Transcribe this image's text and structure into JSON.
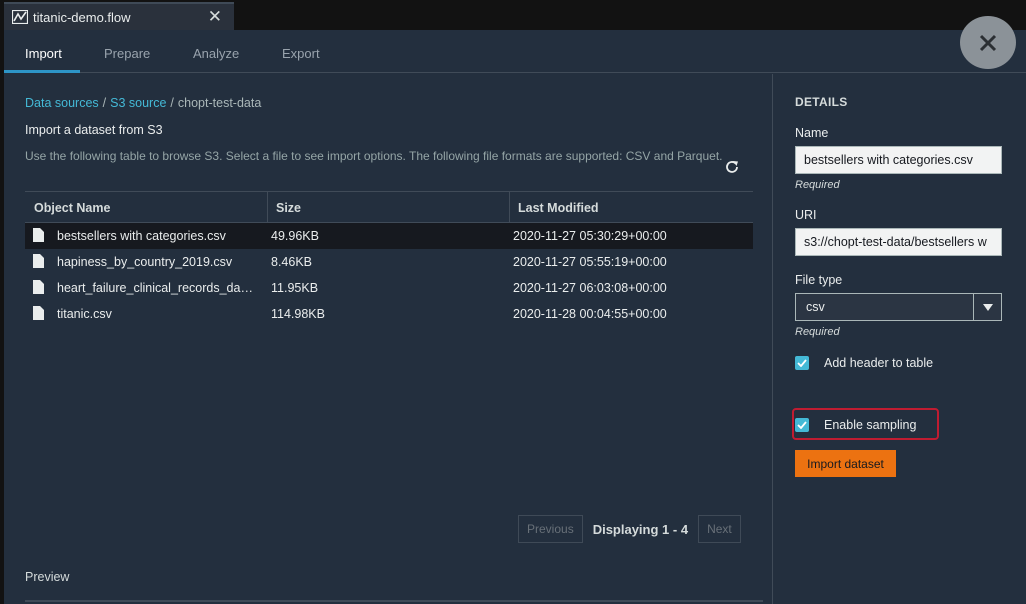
{
  "file_tab": {
    "name": "titanic-demo.flow",
    "close_glyph": "✕",
    "icon": "flow-icon"
  },
  "nav": {
    "tabs": [
      {
        "label": "Import",
        "active": true
      },
      {
        "label": "Prepare",
        "active": false
      },
      {
        "label": "Analyze",
        "active": false
      },
      {
        "label": "Export",
        "active": false
      }
    ],
    "close_icon": "close-icon"
  },
  "breadcrumb": {
    "items": [
      "Data sources",
      "S3 source",
      "chopt-test-data"
    ],
    "separator": "/"
  },
  "main": {
    "title": "Import a dataset from S3",
    "description": "Use the following table to browse S3. Select a file to see import options. The following file formats are supported: CSV and Parquet.",
    "refresh_icon": "refresh-icon"
  },
  "table": {
    "columns": [
      "Object Name",
      "Size",
      "Last Modified"
    ],
    "rows": [
      {
        "name": "bestsellers with categories.csv",
        "size": "49.96KB",
        "modified": "2020-11-27 05:30:29+00:00",
        "selected": true
      },
      {
        "name": "hapiness_by_country_2019.csv",
        "size": "8.46KB",
        "modified": "2020-11-27 05:55:19+00:00",
        "selected": false
      },
      {
        "name": "heart_failure_clinical_records_da…",
        "size": "11.95KB",
        "modified": "2020-11-27 06:03:08+00:00",
        "selected": false
      },
      {
        "name": "titanic.csv",
        "size": "114.98KB",
        "modified": "2020-11-28 00:04:55+00:00",
        "selected": false
      }
    ]
  },
  "pagination": {
    "previous": "Previous",
    "status": "Displaying 1 - 4",
    "next": "Next"
  },
  "preview": {
    "label": "Preview"
  },
  "details": {
    "title": "DETAILS",
    "name_label": "Name",
    "name_value": "bestsellers with categories.csv",
    "name_hint": "Required",
    "uri_label": "URI",
    "uri_value": "s3://chopt-test-data/bestsellers w",
    "file_type_label": "File type",
    "file_type_value": "csv",
    "file_type_hint": "Required",
    "add_header_label": "Add header to table",
    "add_header_checked": true,
    "enable_sampling_label": "Enable sampling",
    "enable_sampling_checked": true,
    "import_button": "Import dataset"
  },
  "colors": {
    "background": "#232f3e",
    "link": "#44b9d6",
    "accent_button": "#ec7211",
    "highlight": "#c01c31",
    "checkbox": "#44b9d6"
  }
}
